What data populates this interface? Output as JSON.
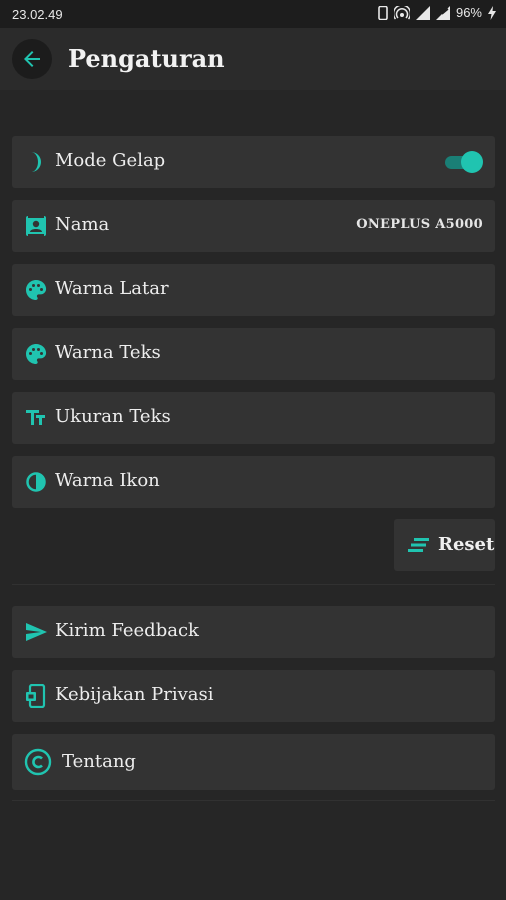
{
  "status": {
    "time": "23.02.49",
    "battery": "96%"
  },
  "header": {
    "title": "Pengaturan"
  },
  "settings": {
    "dark_mode_label": "Mode Gelap",
    "dark_mode_on": true,
    "name_label": "Nama",
    "name_value": "ONEPLUS A5000",
    "bg_color_label": "Warna Latar",
    "text_color_label": "Warna Teks",
    "text_size_label": "Ukuran Teks",
    "icon_color_label": "Warna Ikon",
    "reset_label": "Reset"
  },
  "about": {
    "feedback_label": "Kirim Feedback",
    "privacy_label": "Kebijakan Privasi",
    "about_label": "Tentang"
  },
  "colors": {
    "accent": "#20c4b0",
    "background": "#262626",
    "card": "#333333"
  }
}
